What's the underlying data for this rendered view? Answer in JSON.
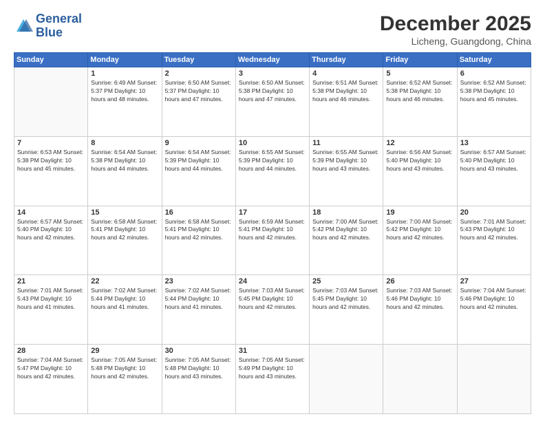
{
  "logo": {
    "line1": "General",
    "line2": "Blue"
  },
  "title": "December 2025",
  "subtitle": "Licheng, Guangdong, China",
  "weekdays": [
    "Sunday",
    "Monday",
    "Tuesday",
    "Wednesday",
    "Thursday",
    "Friday",
    "Saturday"
  ],
  "weeks": [
    [
      {
        "day": "",
        "info": ""
      },
      {
        "day": "1",
        "info": "Sunrise: 6:49 AM\nSunset: 5:37 PM\nDaylight: 10 hours\nand 48 minutes."
      },
      {
        "day": "2",
        "info": "Sunrise: 6:50 AM\nSunset: 5:37 PM\nDaylight: 10 hours\nand 47 minutes."
      },
      {
        "day": "3",
        "info": "Sunrise: 6:50 AM\nSunset: 5:38 PM\nDaylight: 10 hours\nand 47 minutes."
      },
      {
        "day": "4",
        "info": "Sunrise: 6:51 AM\nSunset: 5:38 PM\nDaylight: 10 hours\nand 46 minutes."
      },
      {
        "day": "5",
        "info": "Sunrise: 6:52 AM\nSunset: 5:38 PM\nDaylight: 10 hours\nand 46 minutes."
      },
      {
        "day": "6",
        "info": "Sunrise: 6:52 AM\nSunset: 5:38 PM\nDaylight: 10 hours\nand 45 minutes."
      }
    ],
    [
      {
        "day": "7",
        "info": "Sunrise: 6:53 AM\nSunset: 5:38 PM\nDaylight: 10 hours\nand 45 minutes."
      },
      {
        "day": "8",
        "info": "Sunrise: 6:54 AM\nSunset: 5:38 PM\nDaylight: 10 hours\nand 44 minutes."
      },
      {
        "day": "9",
        "info": "Sunrise: 6:54 AM\nSunset: 5:39 PM\nDaylight: 10 hours\nand 44 minutes."
      },
      {
        "day": "10",
        "info": "Sunrise: 6:55 AM\nSunset: 5:39 PM\nDaylight: 10 hours\nand 44 minutes."
      },
      {
        "day": "11",
        "info": "Sunrise: 6:55 AM\nSunset: 5:39 PM\nDaylight: 10 hours\nand 43 minutes."
      },
      {
        "day": "12",
        "info": "Sunrise: 6:56 AM\nSunset: 5:40 PM\nDaylight: 10 hours\nand 43 minutes."
      },
      {
        "day": "13",
        "info": "Sunrise: 6:57 AM\nSunset: 5:40 PM\nDaylight: 10 hours\nand 43 minutes."
      }
    ],
    [
      {
        "day": "14",
        "info": "Sunrise: 6:57 AM\nSunset: 5:40 PM\nDaylight: 10 hours\nand 42 minutes."
      },
      {
        "day": "15",
        "info": "Sunrise: 6:58 AM\nSunset: 5:41 PM\nDaylight: 10 hours\nand 42 minutes."
      },
      {
        "day": "16",
        "info": "Sunrise: 6:58 AM\nSunset: 5:41 PM\nDaylight: 10 hours\nand 42 minutes."
      },
      {
        "day": "17",
        "info": "Sunrise: 6:59 AM\nSunset: 5:41 PM\nDaylight: 10 hours\nand 42 minutes."
      },
      {
        "day": "18",
        "info": "Sunrise: 7:00 AM\nSunset: 5:42 PM\nDaylight: 10 hours\nand 42 minutes."
      },
      {
        "day": "19",
        "info": "Sunrise: 7:00 AM\nSunset: 5:42 PM\nDaylight: 10 hours\nand 42 minutes."
      },
      {
        "day": "20",
        "info": "Sunrise: 7:01 AM\nSunset: 5:43 PM\nDaylight: 10 hours\nand 42 minutes."
      }
    ],
    [
      {
        "day": "21",
        "info": "Sunrise: 7:01 AM\nSunset: 5:43 PM\nDaylight: 10 hours\nand 41 minutes."
      },
      {
        "day": "22",
        "info": "Sunrise: 7:02 AM\nSunset: 5:44 PM\nDaylight: 10 hours\nand 41 minutes."
      },
      {
        "day": "23",
        "info": "Sunrise: 7:02 AM\nSunset: 5:44 PM\nDaylight: 10 hours\nand 41 minutes."
      },
      {
        "day": "24",
        "info": "Sunrise: 7:03 AM\nSunset: 5:45 PM\nDaylight: 10 hours\nand 42 minutes."
      },
      {
        "day": "25",
        "info": "Sunrise: 7:03 AM\nSunset: 5:45 PM\nDaylight: 10 hours\nand 42 minutes."
      },
      {
        "day": "26",
        "info": "Sunrise: 7:03 AM\nSunset: 5:46 PM\nDaylight: 10 hours\nand 42 minutes."
      },
      {
        "day": "27",
        "info": "Sunrise: 7:04 AM\nSunset: 5:46 PM\nDaylight: 10 hours\nand 42 minutes."
      }
    ],
    [
      {
        "day": "28",
        "info": "Sunrise: 7:04 AM\nSunset: 5:47 PM\nDaylight: 10 hours\nand 42 minutes."
      },
      {
        "day": "29",
        "info": "Sunrise: 7:05 AM\nSunset: 5:48 PM\nDaylight: 10 hours\nand 42 minutes."
      },
      {
        "day": "30",
        "info": "Sunrise: 7:05 AM\nSunset: 5:48 PM\nDaylight: 10 hours\nand 43 minutes."
      },
      {
        "day": "31",
        "info": "Sunrise: 7:05 AM\nSunset: 5:49 PM\nDaylight: 10 hours\nand 43 minutes."
      },
      {
        "day": "",
        "info": ""
      },
      {
        "day": "",
        "info": ""
      },
      {
        "day": "",
        "info": ""
      }
    ]
  ]
}
